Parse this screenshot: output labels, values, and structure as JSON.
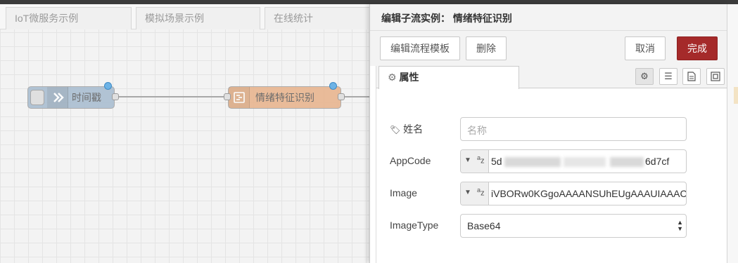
{
  "workspace": {
    "tabs": [
      "IoT微服务示例",
      "模拟场景示例",
      "在线统计"
    ],
    "nodes": {
      "timestamp": {
        "label": "时间戳",
        "icon": "arrow-icon"
      },
      "subflow": {
        "label": "情绪特征识别",
        "icon": "subflow-icon"
      }
    },
    "colors": {
      "inject_node": "#a6bbcf",
      "subflow_node": "#e8b28a",
      "changed_dot": "#6db3e6"
    }
  },
  "tray": {
    "title": "编辑子流实例： 情绪特征识别",
    "buttons": {
      "edit_template": "编辑流程模板",
      "delete": "删除",
      "cancel": "取消",
      "done": "完成"
    },
    "properties_tab": "属性",
    "form": {
      "name_label": "姓名",
      "name_placeholder": "名称",
      "appcode_label": "AppCode",
      "appcode_type": "az",
      "appcode_value_start": "5d",
      "appcode_value_end": "6d7cf",
      "image_label": "Image",
      "image_type": "az",
      "image_value": "iVBORw0KGgoAAAANSUhEUgAAAUIAAAC",
      "imagetype_label": "ImageType",
      "imagetype_value": "Base64"
    },
    "colors": {
      "done_button": "#a52a2a"
    }
  }
}
